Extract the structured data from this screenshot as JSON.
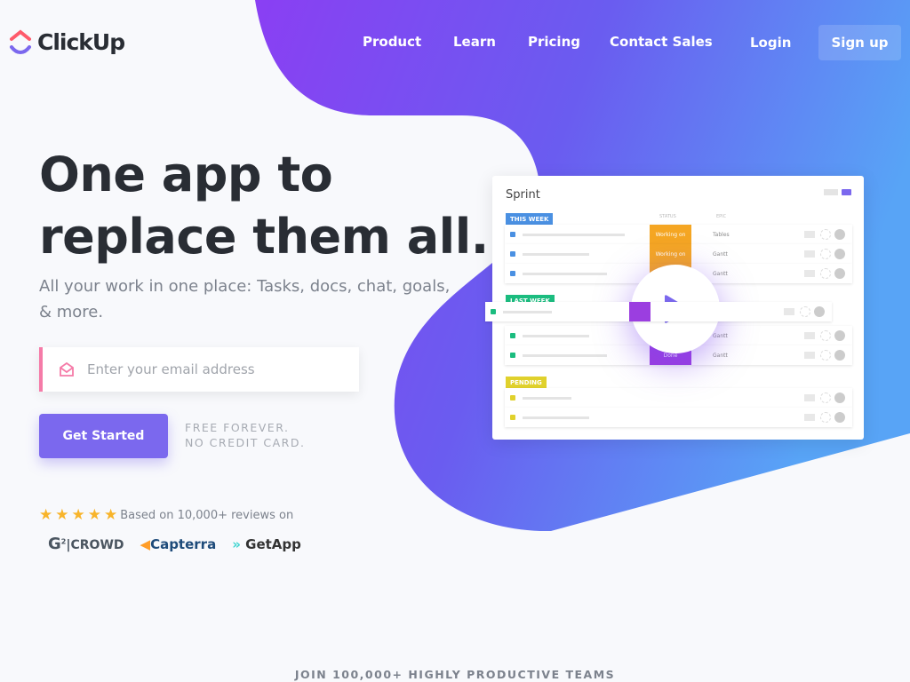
{
  "brand": {
    "name": "ClickUp"
  },
  "nav": {
    "items": [
      "Product",
      "Learn",
      "Pricing",
      "Contact Sales"
    ],
    "login": "Login",
    "signup": "Sign up"
  },
  "hero": {
    "title_line1": "One app to",
    "title_line2": "replace them all.",
    "subtitle": "All your work in one place: Tasks, docs, chat, goals, & more.",
    "email_placeholder": "Enter your email address",
    "cta": "Get Started",
    "free_line1": "FREE FOREVER.",
    "free_line2": "NO CREDIT CARD."
  },
  "reviews": {
    "rating": 5,
    "text": "Based on 10,000+ reviews on",
    "brands": [
      "CROWD",
      "Capterra",
      "GetApp"
    ]
  },
  "preview": {
    "title": "Sprint",
    "col_status": "STATUS",
    "col_epic": "EPIC",
    "groups": [
      {
        "label": "THIS WEEK",
        "color": "#4a90e2",
        "rows": [
          {
            "status": "Working on",
            "epic": "Tables"
          },
          {
            "status": "Working on",
            "epic": "Gantt"
          },
          {
            "status": "",
            "epic": "Gantt"
          }
        ]
      },
      {
        "label": "LAST WEEK",
        "color": "#1bbc7f",
        "rows": [
          {
            "status": "",
            "epic": ""
          },
          {
            "status": "",
            "epic": "Gantt"
          },
          {
            "status": "Done",
            "epic": "Gantt"
          }
        ]
      },
      {
        "label": "PENDING",
        "color": "#e0d12c",
        "rows": [
          {
            "status": "",
            "epic": ""
          },
          {
            "status": "",
            "epic": ""
          }
        ]
      }
    ],
    "colors": {
      "working": "#f5a623",
      "done": "#9b3ee0"
    }
  },
  "footer": {
    "join": "JOIN 100,000+ HIGHLY PRODUCTIVE TEAMS"
  },
  "colors": {
    "accent": "#7b68ee",
    "gradient_start": "#7b3ff2",
    "gradient_end": "#5aa6f6",
    "star": "#f8b42a"
  }
}
